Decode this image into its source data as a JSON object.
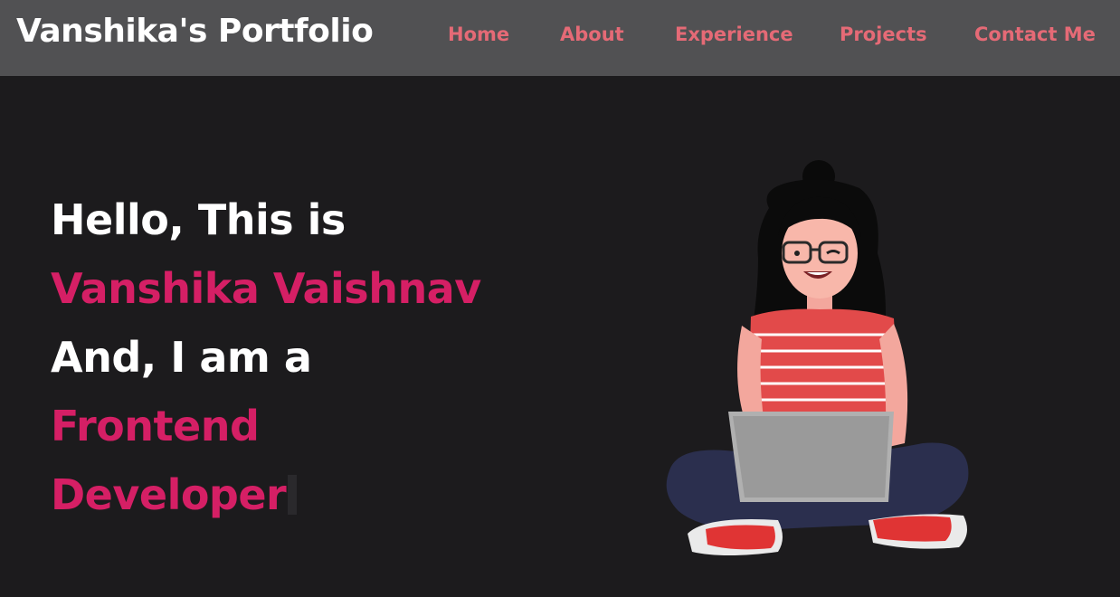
{
  "navbar": {
    "brand": "Vanshika's Portfolio",
    "links": [
      "Home",
      "About",
      "Experience",
      "Projects",
      "Contact Me"
    ]
  },
  "hero": {
    "line1": "Hello, This is",
    "name": "Vanshika Vaishnav",
    "line3": "And, I am a",
    "role_line1": "Frontend",
    "role_line2": "Developer"
  },
  "colors": {
    "background": "#1c1b1d",
    "navbar": "#515153",
    "nav_link": "#e56a76",
    "accent": "#d51f65",
    "text": "#ffffff"
  },
  "illustration": {
    "icon": "girl-with-laptop-illustration"
  }
}
